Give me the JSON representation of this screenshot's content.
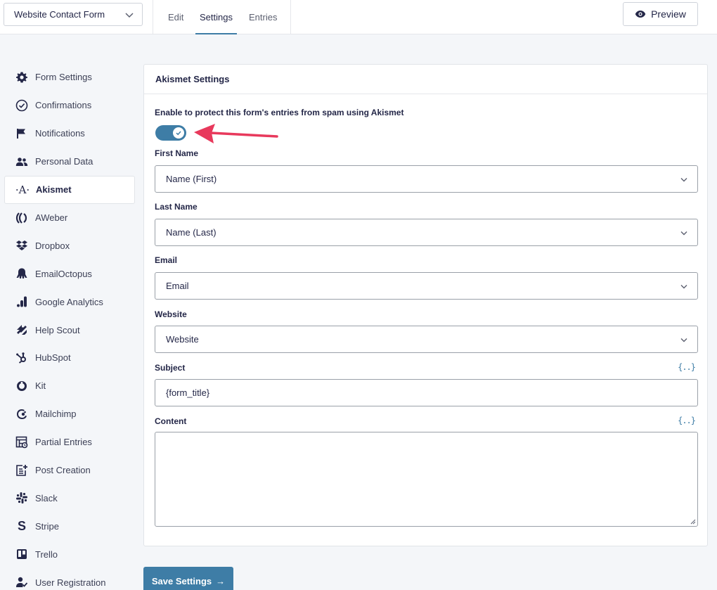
{
  "header": {
    "form_name": "Website Contact Form",
    "tabs": [
      {
        "label": "Edit"
      },
      {
        "label": "Settings"
      },
      {
        "label": "Entries"
      }
    ],
    "preview_label": "Preview"
  },
  "sidebar": {
    "items": [
      {
        "label": "Form Settings",
        "icon": "gear-icon"
      },
      {
        "label": "Confirmations",
        "icon": "check-circle-icon"
      },
      {
        "label": "Notifications",
        "icon": "flag-icon"
      },
      {
        "label": "Personal Data",
        "icon": "users-icon"
      },
      {
        "label": "Akismet",
        "icon": "akismet-icon"
      },
      {
        "label": "AWeber",
        "icon": "aweber-icon"
      },
      {
        "label": "Dropbox",
        "icon": "dropbox-icon"
      },
      {
        "label": "EmailOctopus",
        "icon": "octopus-icon"
      },
      {
        "label": "Google Analytics",
        "icon": "analytics-icon"
      },
      {
        "label": "Help Scout",
        "icon": "helpscout-icon"
      },
      {
        "label": "HubSpot",
        "icon": "hubspot-icon"
      },
      {
        "label": "Kit",
        "icon": "kit-icon"
      },
      {
        "label": "Mailchimp",
        "icon": "mailchimp-icon"
      },
      {
        "label": "Partial Entries",
        "icon": "partial-entries-icon"
      },
      {
        "label": "Post Creation",
        "icon": "post-creation-icon"
      },
      {
        "label": "Slack",
        "icon": "slack-icon"
      },
      {
        "label": "Stripe",
        "icon": "stripe-icon"
      },
      {
        "label": "Trello",
        "icon": "trello-icon"
      },
      {
        "label": "User Registration",
        "icon": "user-check-icon"
      }
    ],
    "active": "Akismet"
  },
  "panel": {
    "title": "Akismet Settings",
    "toggle_description": "Enable to protect this form's entries from spam using Akismet",
    "toggle_on": true,
    "fields": {
      "first_name": {
        "label": "First Name",
        "value": "Name (First)"
      },
      "last_name": {
        "label": "Last Name",
        "value": "Name (Last)"
      },
      "email": {
        "label": "Email",
        "value": "Email"
      },
      "website": {
        "label": "Website",
        "value": "Website"
      },
      "subject": {
        "label": "Subject",
        "value": "{form_title}"
      },
      "content": {
        "label": "Content",
        "value": ""
      }
    },
    "merge_tag_symbol": "{..}"
  },
  "footer": {
    "save_label": "Save Settings",
    "save_arrow": "→"
  },
  "colors": {
    "accent": "#3e7da6",
    "annotation_arrow": "#e8395c"
  }
}
